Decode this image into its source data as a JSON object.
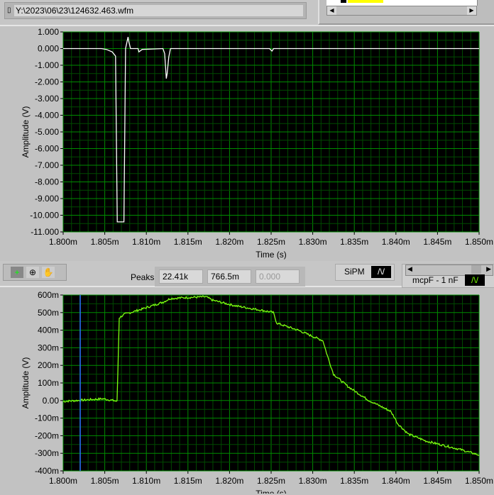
{
  "file_path": "Y:\\2023\\06\\23\\124632.463.wfm",
  "toolbar": {
    "peaks_label": "Peaks",
    "peak_values": [
      "22.41k",
      "766.5m",
      "0.000"
    ],
    "sipm_label": "SiPM",
    "mcp_label": "mcpF - 1 nF"
  },
  "colors": {
    "plot_bg": "#000000",
    "grid_major": "#008c00",
    "grid_minor": "#004a00",
    "trace_top": "#ffffff",
    "trace_bottom": "#7cff10",
    "cursor": "#2b6cff"
  },
  "chart_data": [
    {
      "type": "line",
      "title": "",
      "xlabel": "Time (s)",
      "ylabel": "Amplitude (V)",
      "xlim": [
        1.8,
        1.85
      ],
      "ylim": [
        -11,
        1
      ],
      "xticks": [
        "1.800m",
        "1.805m",
        "1.810m",
        "1.815m",
        "1.820m",
        "1.825m",
        "1.830m",
        "1.835m",
        "1.840m",
        "1.845m",
        "1.850m"
      ],
      "yticks": [
        "1.000",
        "0.000",
        "-1.000",
        "-2.000",
        "-3.000",
        "-4.000",
        "-5.000",
        "-6.000",
        "-7.000",
        "-8.000",
        "-9.000",
        "-10.000",
        "-11.000"
      ],
      "x_unit": "ms",
      "x": [
        1.8,
        1.8046,
        1.8052,
        1.8059,
        1.8063,
        1.8065,
        1.8073,
        1.8075,
        1.8078,
        1.8079,
        1.8081,
        1.809,
        1.8091,
        1.8095,
        1.812,
        1.8122,
        1.8124,
        1.8125,
        1.8127,
        1.8129,
        1.8248,
        1.8251,
        1.8253,
        1.85
      ],
      "y": [
        0,
        0,
        -0.05,
        -0.2,
        -0.45,
        -10.4,
        -10.4,
        0,
        0.7,
        0.4,
        0,
        0,
        -0.2,
        -0.05,
        0,
        -0.3,
        -1.8,
        -1.5,
        -0.5,
        0,
        0,
        -0.15,
        0,
        0
      ]
    },
    {
      "type": "line",
      "title": "",
      "xlabel": "Time (s)",
      "ylabel": "Amplitude (V)",
      "xlim": [
        1.8,
        1.85
      ],
      "ylim": [
        -0.4,
        0.6
      ],
      "xticks": [
        "1.800m",
        "1.805m",
        "1.810m",
        "1.815m",
        "1.820m",
        "1.825m",
        "1.830m",
        "1.835m",
        "1.840m",
        "1.845m",
        "1.850m"
      ],
      "yticks": [
        "600m",
        "500m",
        "400m",
        "300m",
        "200m",
        "100m",
        "0.00",
        "-100m",
        "-200m",
        "-300m",
        "-400m"
      ],
      "x_unit": "ms",
      "cursor_x": 1.80205,
      "x": [
        1.8,
        1.80478,
        1.80606,
        1.80648,
        1.80674,
        1.80734,
        1.80947,
        1.81203,
        1.81288,
        1.81459,
        1.81715,
        1.818,
        1.82056,
        1.82483,
        1.82526,
        1.82568,
        1.82824,
        1.83123,
        1.83166,
        1.8325,
        1.83422,
        1.83677,
        1.83933,
        1.83976,
        1.84019,
        1.84147,
        1.8436,
        1.84787,
        1.85
      ],
      "y": [
        -0.005,
        0.01,
        0,
        -0.005,
        0.47,
        0.49,
        0.52,
        0.56,
        0.58,
        0.585,
        0.59,
        0.57,
        0.54,
        0.505,
        0.5,
        0.44,
        0.4,
        0.34,
        0.27,
        0.15,
        0.08,
        0,
        -0.06,
        -0.09,
        -0.13,
        -0.19,
        -0.23,
        -0.28,
        -0.31
      ]
    }
  ]
}
